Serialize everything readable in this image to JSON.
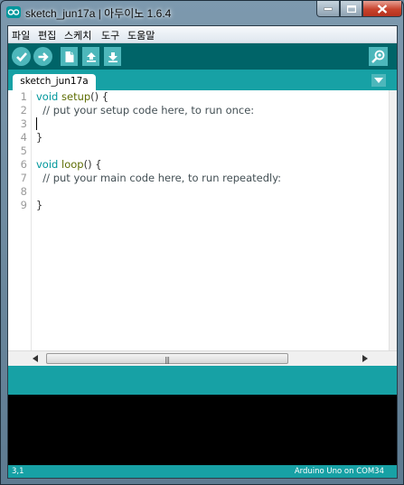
{
  "window": {
    "title": "sketch_jun17a | 아두이노 1.6.4"
  },
  "menu": {
    "items": [
      "파일",
      "편집",
      "스케치",
      "도구",
      "도움말"
    ]
  },
  "toolbar": {
    "icons": [
      "verify-icon",
      "upload-icon",
      "new-icon",
      "open-icon",
      "save-icon",
      "serial-monitor-icon"
    ]
  },
  "tab": {
    "name": "sketch_jun17a"
  },
  "editor": {
    "line_numbers": [
      "1",
      "2",
      "3",
      "4",
      "5",
      "6",
      "7",
      "8",
      "9"
    ],
    "lines": {
      "l1_kw": "void",
      "l1_fn": "setup",
      "l1_rest": "() {",
      "l2": "  // put your setup code here, to run once:",
      "l4": "}",
      "l6_kw": "void",
      "l6_fn": "loop",
      "l6_rest": "() {",
      "l7": "  // put your main code here, to run repeatedly:",
      "l9": "}"
    }
  },
  "status": {
    "line_position": "3,1",
    "board_port": "Arduino Uno on COM34"
  },
  "colors": {
    "teal_dark": "#006468",
    "teal": "#17a1a5",
    "teal_light": "#4db7bb",
    "keyword": "#00979c"
  }
}
